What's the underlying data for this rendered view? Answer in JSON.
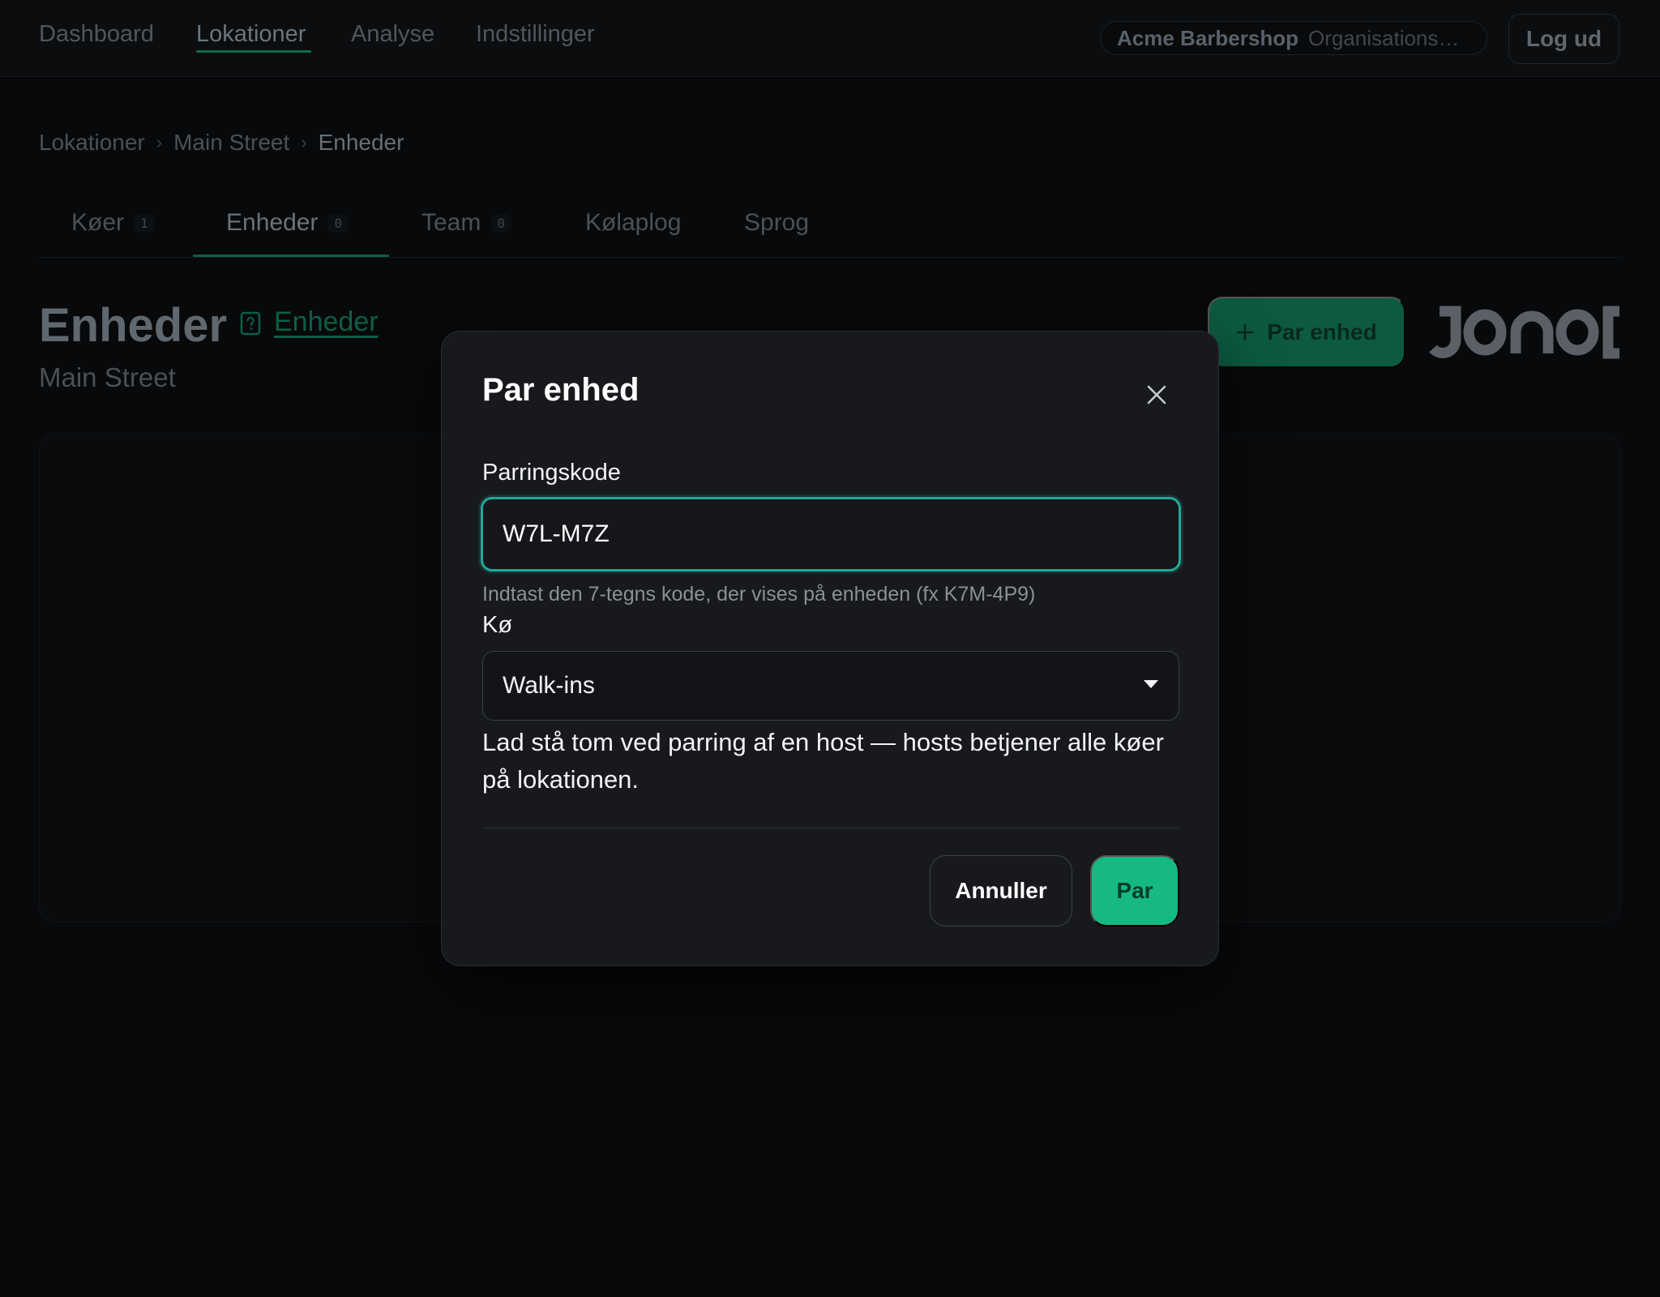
{
  "nav": {
    "items": [
      {
        "label": "Dashboard"
      },
      {
        "label": "Lokationer"
      },
      {
        "label": "Analyse"
      },
      {
        "label": "Indstillinger"
      }
    ],
    "active": "Lokationer",
    "org_name": "Acme Barbershop",
    "org_role": "Organisationsans...",
    "logout_label": "Log ud"
  },
  "breadcrumb": [
    "Lokationer",
    "Main Street",
    "Enheder"
  ],
  "breadcrumb_separator": "›",
  "tabs": [
    {
      "label": "Køer",
      "count": "1"
    },
    {
      "label": "Enheder",
      "count": "0"
    },
    {
      "label": "Team",
      "count": "0"
    },
    {
      "label": "Kølaplog"
    },
    {
      "label": "Sprog"
    }
  ],
  "page": {
    "title": "Enheder",
    "help_link": "Enheder",
    "subtitle": "Main Street",
    "pair_button": "Par enhed",
    "pair_button_icon": "plus-icon"
  },
  "modal": {
    "title": "Par enhed",
    "code_label": "Parringskode",
    "code_value": "W7L-M7Z",
    "code_hint": "Indtast den 7-tegns kode, der vises på enheden (fx K7M-4P9)",
    "queue_label": "Kø",
    "queue_value": "Walk-ins",
    "queue_help": "Lad stå tom ved parring af en host — hosts betjener alle køer på lokationen.",
    "cancel_label": "Annuller",
    "submit_label": "Par"
  },
  "colors": {
    "accent": "#16b981",
    "focus_ring": "#23a89a",
    "background": "#07090b",
    "modal_background": "#17191d"
  }
}
